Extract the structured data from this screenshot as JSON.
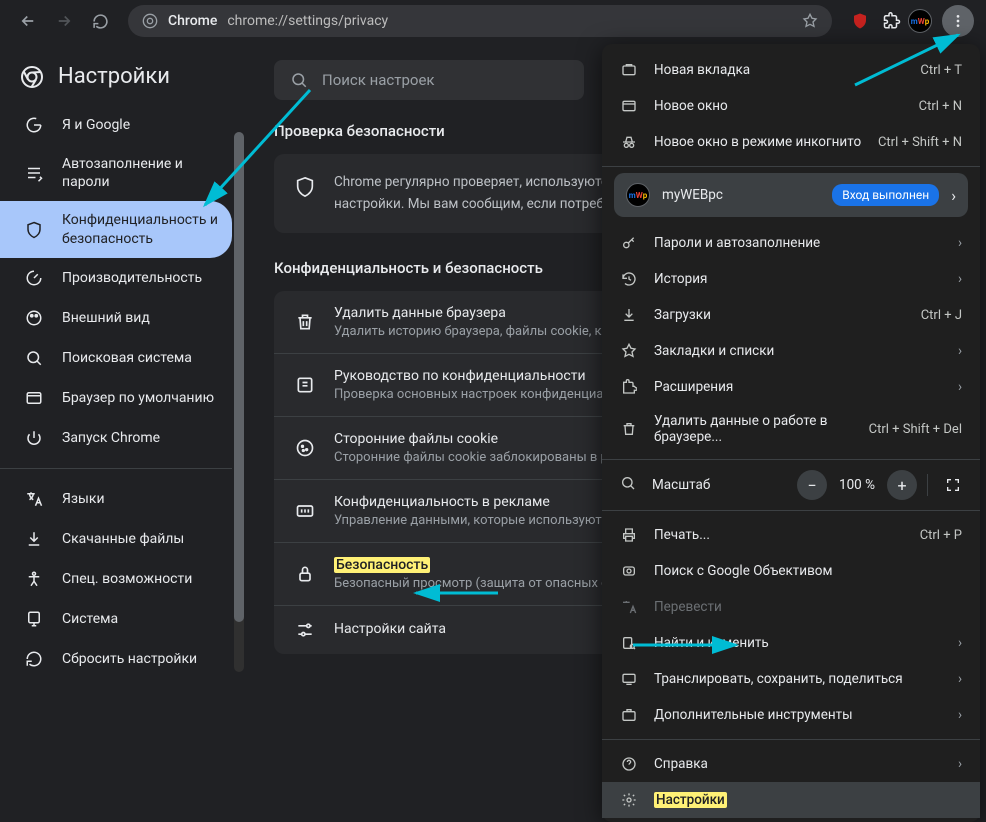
{
  "toolbar": {
    "url_label": "Chrome",
    "url": "chrome://settings/privacy"
  },
  "settings": {
    "title": "Настройки",
    "search_placeholder": "Поиск настроек"
  },
  "sidebar": [
    {
      "label": "Я и Google"
    },
    {
      "label": "Автозаполнение и пароли"
    },
    {
      "label": "Конфиденциальность и безопасность"
    },
    {
      "label": "Производительность"
    },
    {
      "label": "Внешний вид"
    },
    {
      "label": "Поисковая система"
    },
    {
      "label": "Браузер по умолчанию"
    },
    {
      "label": "Запуск Chrome"
    },
    {
      "label": "Языки"
    },
    {
      "label": "Скачанные файлы"
    },
    {
      "label": "Спец. возможности"
    },
    {
      "label": "Система"
    },
    {
      "label": "Сбросить настройки"
    }
  ],
  "main": {
    "safety_title": "Проверка безопасности",
    "safety_text": "Chrome регулярно проверяет, используются ли в браузере максимально безопасные настройки. Мы вам сообщим, если потребуется ваше участие.",
    "privacy_title": "Конфиденциальность и безопасность",
    "rows": [
      {
        "title": "Удалить данные браузера",
        "sub": "Удалить историю браузера, файлы cookie, кеш и т. д."
      },
      {
        "title": "Руководство по конфиденциальности",
        "sub": "Проверка основных настроек конфиденциальности"
      },
      {
        "title": "Сторонние файлы cookie",
        "sub": "Сторонние файлы cookie заблокированы в режиме инкогнито"
      },
      {
        "title": "Конфиденциальность в рекламе",
        "sub": "Управление данными, которые используют сайты"
      },
      {
        "title": "Безопасность",
        "sub": "Безопасный просмотр (защита от опасных сайтов)"
      },
      {
        "title": "Настройки сайта",
        "sub": ""
      }
    ]
  },
  "menu": {
    "profile_name": "myWEBpc",
    "profile_badge": "Вход выполнен",
    "zoom_value": "100 %",
    "items": {
      "new_tab": "Новая вкладка",
      "new_window": "Новое окно",
      "incognito": "Новое окно в режиме инкогнито",
      "passwords": "Пароли и автозаполнение",
      "history": "История",
      "downloads": "Загрузки",
      "bookmarks": "Закладки и списки",
      "extensions": "Расширения",
      "clear_data": "Удалить данные о работе в браузере...",
      "zoom": "Масштаб",
      "print": "Печать...",
      "lens": "Поиск с Google Объективом",
      "translate": "Перевести",
      "find": "Найти и изменить",
      "cast": "Транслировать, сохранить, поделиться",
      "more_tools": "Дополнительные инструменты",
      "help": "Справка",
      "settings": "Настройки"
    },
    "shortcuts": {
      "new_tab": "Ctrl + T",
      "new_window": "Ctrl + N",
      "incognito": "Ctrl + Shift + N",
      "downloads": "Ctrl + J",
      "clear_data": "Ctrl + Shift + Del",
      "print": "Ctrl + P"
    }
  }
}
